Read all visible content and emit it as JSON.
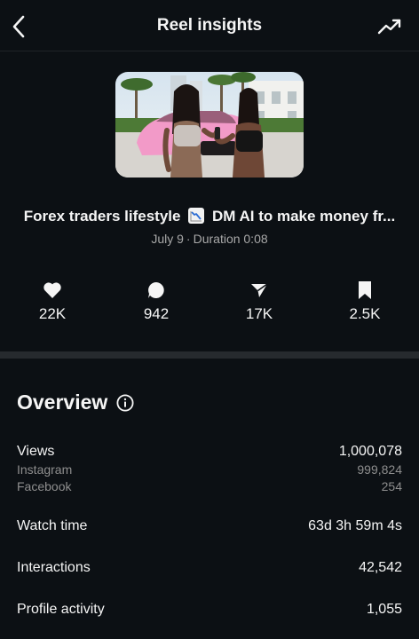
{
  "header": {
    "title": "Reel insights"
  },
  "reel": {
    "caption": "Forex traders lifestyle",
    "caption_emoji": "chart-decreasing-emoji",
    "caption_rest": "DM AI to make money fr...",
    "date": "July 9",
    "separator": "·",
    "duration": "Duration 0:08"
  },
  "stats": {
    "likes": "22K",
    "comments": "942",
    "shares": "17K",
    "saves": "2.5K"
  },
  "overview": {
    "title": "Overview",
    "views_label": "Views",
    "views_value": "1,000,078",
    "instagram_label": "Instagram",
    "instagram_value": "999,824",
    "facebook_label": "Facebook",
    "facebook_value": "254",
    "watch_time_label": "Watch time",
    "watch_time_value": "63d 3h 59m 4s",
    "interactions_label": "Interactions",
    "interactions_value": "42,542",
    "profile_activity_label": "Profile activity",
    "profile_activity_value": "1,055"
  },
  "colors": {
    "background": "#0c1014",
    "text": "#f5f5f5",
    "muted": "#a8a8a8",
    "divider": "#262a2e"
  }
}
